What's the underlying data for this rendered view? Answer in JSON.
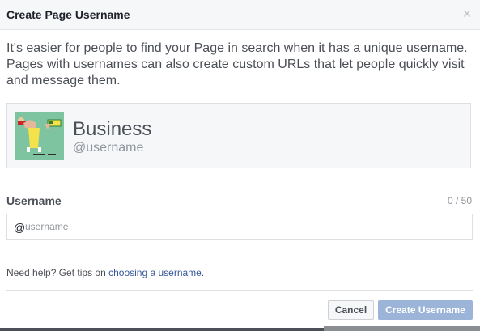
{
  "dialog": {
    "title": "Create Page Username",
    "close_icon": "close-icon",
    "close_glyph": "×",
    "intro": "It's easier for people to find your Page in search when it has a unique username. Pages with usernames can also create custom URLs that let people quickly visit and message them."
  },
  "preview": {
    "page_name": "Business",
    "username": "@username",
    "thumbnail_icon": "page-profile-image"
  },
  "username_field": {
    "label": "Username",
    "counter": "0 / 50",
    "prefix": "@",
    "placeholder": "username",
    "value": ""
  },
  "help": {
    "text": "Need help? Get tips on ",
    "link_text": "choosing a username",
    "suffix": "."
  },
  "buttons": {
    "cancel": "Cancel",
    "create": "Create Username"
  },
  "colors": {
    "link": "#365899",
    "primary_disabled": "#9cb4d8",
    "header_bg": "#f6f7f9"
  }
}
